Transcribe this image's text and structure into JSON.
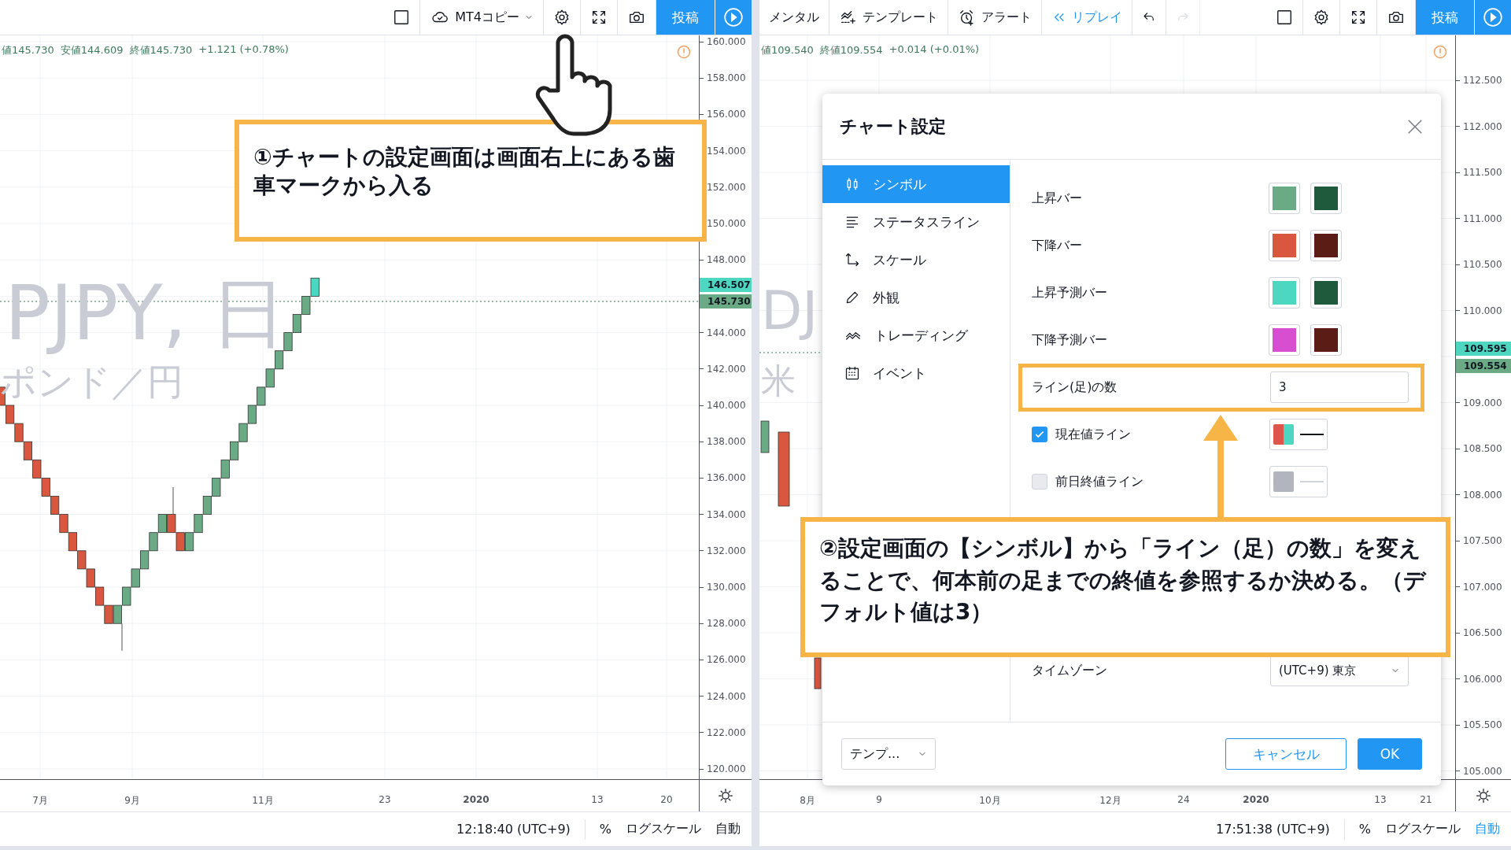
{
  "left_chart": {
    "toolbar": [
      {
        "kind": "layout"
      },
      {
        "kind": "cloud_menu",
        "label": "MT4コピー"
      },
      {
        "kind": "settings"
      },
      {
        "kind": "fullscreen"
      },
      {
        "kind": "snapshot"
      },
      {
        "kind": "publish",
        "label": "投稿"
      },
      {
        "kind": "play"
      }
    ],
    "info": [
      "値145.730",
      "安値144.609",
      "終値145.730",
      "+1.121 (+0.78%)"
    ],
    "watermark": {
      "symbol": "PJPY, 日",
      "description": "ポンド／円"
    },
    "price_labels_upper": [
      "160.000",
      "158.000",
      "156.000",
      "154.000",
      "152.000",
      "150.000",
      "148.000"
    ],
    "price_labels_lower": [
      "144.000",
      "142.000",
      "140.000",
      "138.000",
      "136.000",
      "134.000",
      "132.000",
      "130.000",
      "128.000",
      "126.000",
      "124.000",
      "122.000",
      "120.000"
    ],
    "price_badges": [
      {
        "text": "146.507",
        "color": "#4dd6c0"
      },
      {
        "text": "145.730",
        "color": "#6aaa84"
      }
    ],
    "time_labels": [
      {
        "text": "7月",
        "kind": "month"
      },
      {
        "text": "9月",
        "kind": "month"
      },
      {
        "text": "11月",
        "kind": "month"
      },
      {
        "text": "23",
        "kind": "day"
      },
      {
        "text": "2020",
        "kind": "year"
      },
      {
        "text": "13",
        "kind": "day"
      },
      {
        "text": "20",
        "kind": "day"
      }
    ],
    "status_bar": {
      "time": "12:18:40 (UTC+9)",
      "percent": "%",
      "log_scale": "ログスケール",
      "auto": {
        "label": "自動",
        "selected": false
      }
    }
  },
  "right_chart": {
    "tools": [
      {
        "kind": "menu_text",
        "label": "メンタル"
      },
      {
        "kind": "templates",
        "label": "テンプレート"
      },
      {
        "kind": "alert",
        "label": "アラート"
      },
      {
        "kind": "replay",
        "label": "リプレイ"
      },
      {
        "kind": "undo",
        "disabled": false
      },
      {
        "kind": "redo",
        "disabled": true
      }
    ],
    "toolbar": [
      {
        "kind": "layout"
      },
      {
        "kind": "settings"
      },
      {
        "kind": "fullscreen"
      },
      {
        "kind": "snapshot"
      },
      {
        "kind": "publish",
        "label": "投稿"
      },
      {
        "kind": "play"
      }
    ],
    "info": [
      "値109.540",
      "終値109.554",
      "+0.014 (+0.01%)"
    ],
    "watermark": {
      "symbol": "DJ",
      "description": "米"
    },
    "price_labels_upper": [
      "112.500",
      "112.000",
      "111.500",
      "111.000",
      "110.500",
      "110.000"
    ],
    "price_labels_lower": [
      "109.000",
      "108.500",
      "108.000",
      "107.500",
      "107.000",
      "106.500",
      "106.000",
      "105.500",
      "105.000"
    ],
    "price_badges": [
      {
        "text": "109.595",
        "color": "#4dd6c0"
      },
      {
        "text": "109.554",
        "color": "#6aaa84"
      }
    ],
    "time_labels": [
      {
        "text": "8月",
        "kind": "month"
      },
      {
        "text": "9",
        "kind": "day"
      },
      {
        "text": "10月",
        "kind": "month"
      },
      {
        "text": "12月",
        "kind": "month"
      },
      {
        "text": "24",
        "kind": "day"
      },
      {
        "text": "2020",
        "kind": "year"
      },
      {
        "text": "13",
        "kind": "day"
      },
      {
        "text": "21",
        "kind": "day"
      }
    ],
    "status_bar": {
      "time": "17:51:38 (UTC+9)",
      "percent": "%",
      "log_scale": "ログスケール",
      "auto": {
        "label": "自動",
        "selected": true
      }
    }
  },
  "dialog": {
    "title": "チャート設定",
    "nav": [
      {
        "kind": "symbol",
        "label": "シンボル",
        "selected": true
      },
      {
        "kind": "status_line",
        "label": "ステータスライン",
        "selected": false
      },
      {
        "kind": "scale",
        "label": "スケール",
        "selected": false
      },
      {
        "kind": "appearance",
        "label": "外観",
        "selected": false
      },
      {
        "kind": "trading",
        "label": "トレーディング",
        "selected": false
      },
      {
        "kind": "events",
        "label": "イベント",
        "selected": false
      }
    ],
    "rows": [
      {
        "kind": "colors",
        "label": "上昇バー",
        "swatches": [
          {
            "color": "#6aaa84"
          },
          {
            "color": "#1f5a3c"
          }
        ]
      },
      {
        "kind": "colors",
        "label": "下降バー",
        "swatches": [
          {
            "color": "#d9573f"
          },
          {
            "color": "#5a1c14"
          }
        ]
      },
      {
        "kind": "colors",
        "label": "上昇予測バー",
        "swatches": [
          {
            "color": "#4dd6c0"
          },
          {
            "color": "#1f5a3c"
          }
        ]
      },
      {
        "kind": "colors",
        "label": "下降予測バー",
        "swatches": [
          {
            "color": "#d84ed0"
          },
          {
            "color": "#5a1c14"
          }
        ]
      },
      {
        "kind": "number",
        "label": "ライン(足)の数",
        "value": "3"
      },
      {
        "kind": "line",
        "label": "現在値ライン",
        "checked": true,
        "swatches": [
          {
            "color": "#e0554a"
          },
          {
            "color": "#4dd6c0"
          }
        ]
      },
      {
        "kind": "line",
        "label": "前日終値ライン",
        "checked": false,
        "swatches": [
          {
            "color": "#b2b5be"
          }
        ]
      },
      {
        "kind": "select",
        "label": "タイムゾーン",
        "value": "(UTC+9) 東京"
      }
    ],
    "template_select": "テンプ...",
    "cancel": "キャンセル",
    "ok": "OK"
  },
  "annotations": [
    {
      "text": "①チャートの設定画面は画面右上にある歯車マークから入る"
    },
    {
      "text": "②設定画面の【シンボル】から「ライン（足）の数」を変えることで、何本前の足までの終値を参照するか決める。（デフォルト値は3）"
    }
  ]
}
